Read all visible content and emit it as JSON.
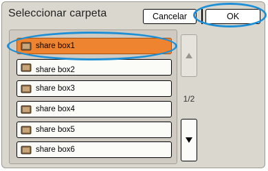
{
  "dialog": {
    "title": "Seleccionar carpeta",
    "cancel_label": "Cancelar",
    "ok_label": "OK"
  },
  "folders": [
    {
      "label": "share box1",
      "selected": true
    },
    {
      "label": "share box2",
      "selected": false
    },
    {
      "label": "share box3",
      "selected": false
    },
    {
      "label": "share box4",
      "selected": false
    },
    {
      "label": "share box5",
      "selected": false
    },
    {
      "label": "share box6",
      "selected": false
    }
  ],
  "pager": {
    "indicator": "1/2",
    "up_icon": "triangle-up-icon",
    "down_icon": "triangle-down-icon"
  },
  "colors": {
    "selected_bg": "#ee8330",
    "highlight_ring": "#1d8fd6",
    "panel_bg": "#dad7cf"
  }
}
